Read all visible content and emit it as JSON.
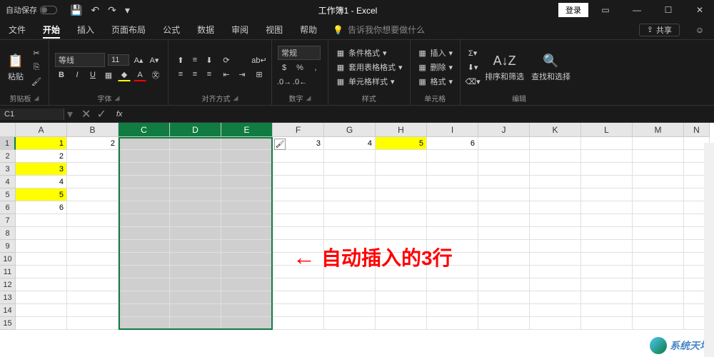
{
  "titlebar": {
    "autosave_label": "自动保存",
    "title": "工作簿1 - Excel",
    "login": "登录"
  },
  "menu": {
    "tabs": [
      "文件",
      "开始",
      "插入",
      "页面布局",
      "公式",
      "数据",
      "审阅",
      "视图",
      "帮助"
    ],
    "active_index": 1,
    "tell_me": "告诉我你想要做什么",
    "share": "共享"
  },
  "ribbon": {
    "clipboard": {
      "paste": "粘贴",
      "label": "剪贴板"
    },
    "font": {
      "name": "等线",
      "size": "11",
      "label": "字体"
    },
    "alignment": {
      "label": "对齐方式"
    },
    "number": {
      "format": "常规",
      "label": "数字"
    },
    "styles": {
      "conditional": "条件格式",
      "table": "套用表格格式",
      "cell": "单元格样式",
      "label": "样式"
    },
    "cells": {
      "insert": "插入",
      "delete": "删除",
      "format": "格式",
      "label": "单元格"
    },
    "editing": {
      "sort": "排序和筛选",
      "find": "查找和选择",
      "label": "编辑"
    }
  },
  "formula_bar": {
    "name_box": "C1",
    "fx": "fx"
  },
  "sheet": {
    "columns": [
      "A",
      "B",
      "C",
      "D",
      "E",
      "F",
      "G",
      "H",
      "I",
      "J",
      "K",
      "L",
      "M",
      "N"
    ],
    "selected_cols": [
      "C",
      "D",
      "E"
    ],
    "rows": 15,
    "data": {
      "r1": {
        "A": "1",
        "B": "2",
        "F": "3",
        "G": "4",
        "H": "5",
        "I": "6"
      },
      "r2": {
        "A": "2"
      },
      "r3": {
        "A": "3"
      },
      "r4": {
        "A": "4"
      },
      "r5": {
        "A": "5"
      },
      "r6": {
        "A": "6"
      }
    },
    "yellow_cells": [
      "A1",
      "A3",
      "A5",
      "H1"
    ]
  },
  "annotation": {
    "text": "自动插入的3行"
  },
  "watermark": "系统天地"
}
